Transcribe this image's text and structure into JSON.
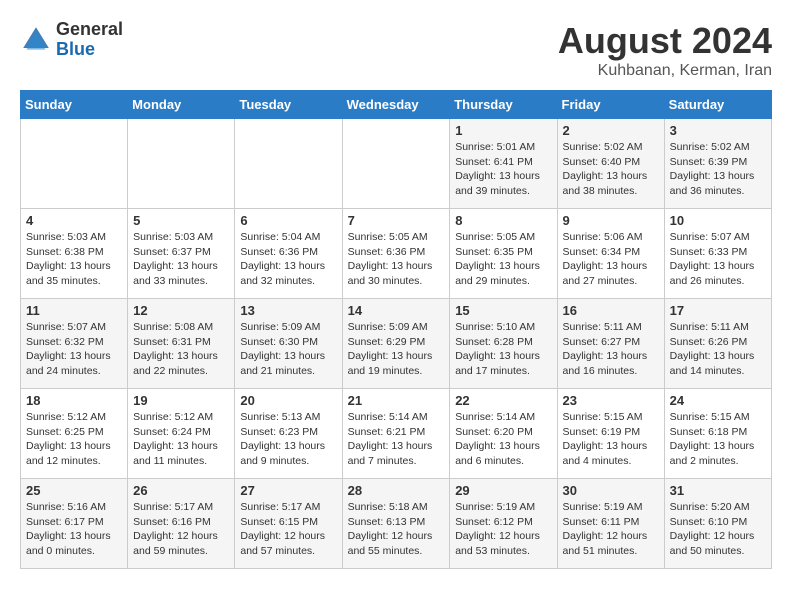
{
  "header": {
    "logo_general": "General",
    "logo_blue": "Blue",
    "title": "August 2024",
    "location": "Kuhbanan, Kerman, Iran"
  },
  "weekdays": [
    "Sunday",
    "Monday",
    "Tuesday",
    "Wednesday",
    "Thursday",
    "Friday",
    "Saturday"
  ],
  "weeks": [
    [
      {
        "day": "",
        "info": ""
      },
      {
        "day": "",
        "info": ""
      },
      {
        "day": "",
        "info": ""
      },
      {
        "day": "",
        "info": ""
      },
      {
        "day": "1",
        "info": "Sunrise: 5:01 AM\nSunset: 6:41 PM\nDaylight: 13 hours\nand 39 minutes."
      },
      {
        "day": "2",
        "info": "Sunrise: 5:02 AM\nSunset: 6:40 PM\nDaylight: 13 hours\nand 38 minutes."
      },
      {
        "day": "3",
        "info": "Sunrise: 5:02 AM\nSunset: 6:39 PM\nDaylight: 13 hours\nand 36 minutes."
      }
    ],
    [
      {
        "day": "4",
        "info": "Sunrise: 5:03 AM\nSunset: 6:38 PM\nDaylight: 13 hours\nand 35 minutes."
      },
      {
        "day": "5",
        "info": "Sunrise: 5:03 AM\nSunset: 6:37 PM\nDaylight: 13 hours\nand 33 minutes."
      },
      {
        "day": "6",
        "info": "Sunrise: 5:04 AM\nSunset: 6:36 PM\nDaylight: 13 hours\nand 32 minutes."
      },
      {
        "day": "7",
        "info": "Sunrise: 5:05 AM\nSunset: 6:36 PM\nDaylight: 13 hours\nand 30 minutes."
      },
      {
        "day": "8",
        "info": "Sunrise: 5:05 AM\nSunset: 6:35 PM\nDaylight: 13 hours\nand 29 minutes."
      },
      {
        "day": "9",
        "info": "Sunrise: 5:06 AM\nSunset: 6:34 PM\nDaylight: 13 hours\nand 27 minutes."
      },
      {
        "day": "10",
        "info": "Sunrise: 5:07 AM\nSunset: 6:33 PM\nDaylight: 13 hours\nand 26 minutes."
      }
    ],
    [
      {
        "day": "11",
        "info": "Sunrise: 5:07 AM\nSunset: 6:32 PM\nDaylight: 13 hours\nand 24 minutes."
      },
      {
        "day": "12",
        "info": "Sunrise: 5:08 AM\nSunset: 6:31 PM\nDaylight: 13 hours\nand 22 minutes."
      },
      {
        "day": "13",
        "info": "Sunrise: 5:09 AM\nSunset: 6:30 PM\nDaylight: 13 hours\nand 21 minutes."
      },
      {
        "day": "14",
        "info": "Sunrise: 5:09 AM\nSunset: 6:29 PM\nDaylight: 13 hours\nand 19 minutes."
      },
      {
        "day": "15",
        "info": "Sunrise: 5:10 AM\nSunset: 6:28 PM\nDaylight: 13 hours\nand 17 minutes."
      },
      {
        "day": "16",
        "info": "Sunrise: 5:11 AM\nSunset: 6:27 PM\nDaylight: 13 hours\nand 16 minutes."
      },
      {
        "day": "17",
        "info": "Sunrise: 5:11 AM\nSunset: 6:26 PM\nDaylight: 13 hours\nand 14 minutes."
      }
    ],
    [
      {
        "day": "18",
        "info": "Sunrise: 5:12 AM\nSunset: 6:25 PM\nDaylight: 13 hours\nand 12 minutes."
      },
      {
        "day": "19",
        "info": "Sunrise: 5:12 AM\nSunset: 6:24 PM\nDaylight: 13 hours\nand 11 minutes."
      },
      {
        "day": "20",
        "info": "Sunrise: 5:13 AM\nSunset: 6:23 PM\nDaylight: 13 hours\nand 9 minutes."
      },
      {
        "day": "21",
        "info": "Sunrise: 5:14 AM\nSunset: 6:21 PM\nDaylight: 13 hours\nand 7 minutes."
      },
      {
        "day": "22",
        "info": "Sunrise: 5:14 AM\nSunset: 6:20 PM\nDaylight: 13 hours\nand 6 minutes."
      },
      {
        "day": "23",
        "info": "Sunrise: 5:15 AM\nSunset: 6:19 PM\nDaylight: 13 hours\nand 4 minutes."
      },
      {
        "day": "24",
        "info": "Sunrise: 5:15 AM\nSunset: 6:18 PM\nDaylight: 13 hours\nand 2 minutes."
      }
    ],
    [
      {
        "day": "25",
        "info": "Sunrise: 5:16 AM\nSunset: 6:17 PM\nDaylight: 13 hours\nand 0 minutes."
      },
      {
        "day": "26",
        "info": "Sunrise: 5:17 AM\nSunset: 6:16 PM\nDaylight: 12 hours\nand 59 minutes."
      },
      {
        "day": "27",
        "info": "Sunrise: 5:17 AM\nSunset: 6:15 PM\nDaylight: 12 hours\nand 57 minutes."
      },
      {
        "day": "28",
        "info": "Sunrise: 5:18 AM\nSunset: 6:13 PM\nDaylight: 12 hours\nand 55 minutes."
      },
      {
        "day": "29",
        "info": "Sunrise: 5:19 AM\nSunset: 6:12 PM\nDaylight: 12 hours\nand 53 minutes."
      },
      {
        "day": "30",
        "info": "Sunrise: 5:19 AM\nSunset: 6:11 PM\nDaylight: 12 hours\nand 51 minutes."
      },
      {
        "day": "31",
        "info": "Sunrise: 5:20 AM\nSunset: 6:10 PM\nDaylight: 12 hours\nand 50 minutes."
      }
    ]
  ]
}
